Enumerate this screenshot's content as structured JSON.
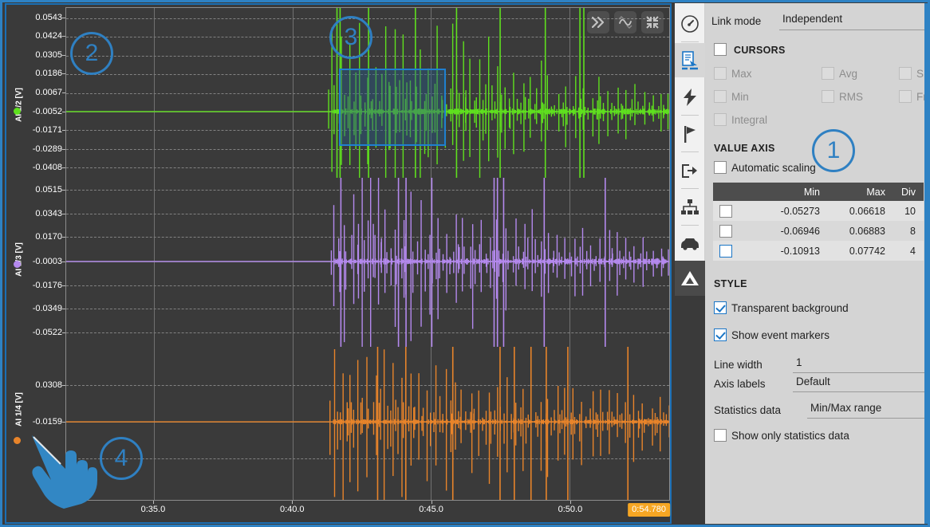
{
  "window": {
    "accent_color": "#2e82c4",
    "plot_bg": "#3a3a3a"
  },
  "chart_data": {
    "type": "line",
    "title": "",
    "xlabel": "",
    "x_ticks": [
      "0:35.0",
      "0:40.0",
      "0:45.0",
      "0:50.0"
    ],
    "x_cursor_label": "0:54.780",
    "grid": true,
    "legend": "left-axis-titles",
    "panels": [
      {
        "name": "AI 1/2 [V]",
        "color": "#5fe01e",
        "ylabel": "AI 1/2 [V]",
        "y_ticks": [
          "0.0543",
          "0.0424",
          "0.0305",
          "0.0186",
          "0.0067",
          "-0.0052",
          "-0.0171",
          "-0.0289",
          "-0.0408"
        ],
        "ylim": [
          -0.05273,
          0.06618
        ],
        "divisions": 10,
        "baseline": -0.0052
      },
      {
        "name": "AI 1/3 [V]",
        "color": "#b489ee",
        "ylabel": "AI 1/3 [V]",
        "y_ticks": [
          "0.0515",
          "0.0343",
          "0.0170",
          "-0.0003",
          "-0.0176",
          "-0.0349",
          "-0.0522"
        ],
        "ylim": [
          -0.06946,
          0.06883
        ],
        "divisions": 8,
        "baseline": -0.0003
      },
      {
        "name": "AI 1/4 [V]",
        "color": "#e8842a",
        "ylabel": "AI 1/4 [V]",
        "y_ticks": [
          "0.0308",
          "-0.0159"
        ],
        "ylim": [
          -0.10913,
          0.07742
        ],
        "divisions": 4,
        "baseline": -0.0159
      }
    ]
  },
  "chart_toolbar": {
    "buttons": [
      {
        "name": "fast-forward-button",
        "glyph": "»"
      },
      {
        "name": "auto-scale-button",
        "glyph": "∿"
      },
      {
        "name": "collapse-button",
        "glyph": "⤢"
      }
    ]
  },
  "annotations": [
    {
      "id": "1",
      "label": "1"
    },
    {
      "id": "2",
      "label": "2"
    },
    {
      "id": "3",
      "label": "3"
    },
    {
      "id": "4",
      "label": "4"
    }
  ],
  "rail": {
    "items": [
      {
        "name": "gauge-icon",
        "label": "Gauge"
      },
      {
        "name": "recorder-icon",
        "label": "Recorder",
        "active": true
      },
      {
        "name": "lightning-icon",
        "label": "Power"
      },
      {
        "name": "flag-icon",
        "label": "Markers"
      },
      {
        "name": "export-icon",
        "label": "Export"
      },
      {
        "name": "network-icon",
        "label": "Network"
      },
      {
        "name": "vehicle-icon",
        "label": "Vehicle"
      },
      {
        "name": "triangle-logo-icon",
        "label": "Logo"
      }
    ]
  },
  "panel": {
    "link_mode": {
      "label": "Link mode",
      "value": "Independent"
    },
    "cursors": {
      "title": "CURSORS",
      "checked": false,
      "options": [
        {
          "label": "Max",
          "checked": false,
          "enabled": false
        },
        {
          "label": "Avg",
          "checked": false,
          "enabled": false
        },
        {
          "label": "S",
          "checked": false,
          "enabled": false
        },
        {
          "label": "Min",
          "checked": false,
          "enabled": false
        },
        {
          "label": "RMS",
          "checked": false,
          "enabled": false
        },
        {
          "label": "Fr",
          "checked": false,
          "enabled": false
        },
        {
          "label": "Integral",
          "checked": false,
          "enabled": false
        }
      ]
    },
    "value_axis": {
      "title": "VALUE AXIS",
      "automatic_scaling": {
        "label": "Automatic scaling",
        "checked": false
      },
      "table": {
        "headers": [
          "",
          "Min",
          "Max",
          "Div"
        ],
        "rows": [
          {
            "checked": false,
            "min": "-0.05273",
            "max": "0.06618",
            "div": "10"
          },
          {
            "checked": false,
            "min": "-0.06946",
            "max": "0.06883",
            "div": "8"
          },
          {
            "checked": false,
            "min": "-0.10913",
            "max": "0.07742",
            "div": "4"
          }
        ]
      }
    },
    "style": {
      "title": "STYLE",
      "transparent_background": {
        "label": "Transparent background",
        "checked": true
      },
      "show_event_markers": {
        "label": "Show event markers",
        "checked": true
      },
      "line_width": {
        "label": "Line width",
        "value": "1"
      },
      "axis_labels": {
        "label": "Axis labels",
        "value": "Default"
      },
      "statistics_data": {
        "label": "Statistics data",
        "value": "Min/Max range"
      },
      "show_only_statistics": {
        "label": "Show only statistics data",
        "checked": false
      }
    }
  }
}
